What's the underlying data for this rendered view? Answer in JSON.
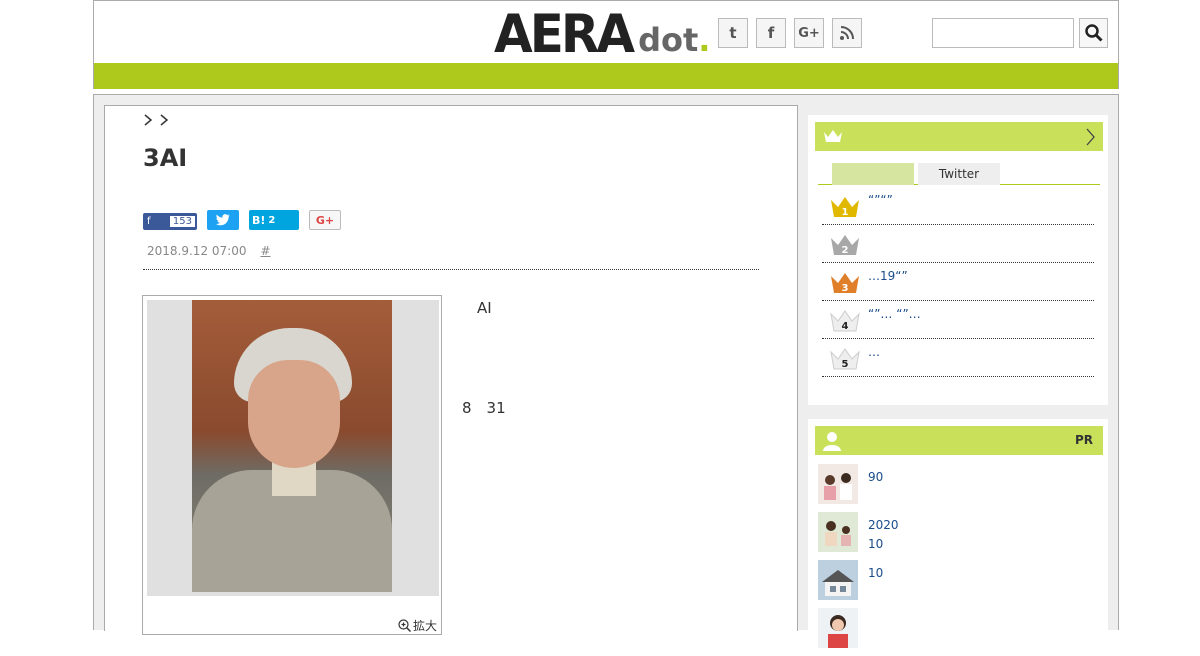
{
  "header": {
    "logo_main": "AERA",
    "logo_sub": "dot",
    "logo_period": ".",
    "social": [
      {
        "icon": "twitter-icon",
        "glyph": "t"
      },
      {
        "icon": "facebook-icon",
        "glyph": "f"
      },
      {
        "icon": "google-plus-icon",
        "glyph": "G+"
      },
      {
        "icon": "rss-icon",
        "glyph": ")"
      }
    ],
    "search_placeholder": ""
  },
  "article": {
    "title": "3AI",
    "share": {
      "facebook_count": "153",
      "hatena_label": "B!",
      "hatena_count": "2",
      "gplus_label": "G+"
    },
    "date": "2018.9.12 07:00",
    "tag": "#",
    "zoom_label": "拡大",
    "paragraphs": [
      "　AI　",
      "",
      "8　31　　",
      ""
    ],
    "link_text": "　"
  },
  "ranking": {
    "tabs": [
      "",
      "Twitter"
    ],
    "items": [
      {
        "rank": "1",
        "text": "“”“”"
      },
      {
        "rank": "2",
        "text": ""
      },
      {
        "rank": "3",
        "text": "…19“”"
      },
      {
        "rank": "4",
        "text": "“”… “”…"
      },
      {
        "rank": "5",
        "text": "…"
      }
    ]
  },
  "pr": {
    "label": "PR",
    "items": [
      {
        "text": "90"
      },
      {
        "text": "2020\n10"
      },
      {
        "text": "10"
      },
      {
        "text": ""
      }
    ]
  },
  "colors": {
    "accent_green": "#aec81c",
    "light_green": "#c9e15a",
    "link_blue": "#1a4c8c"
  }
}
